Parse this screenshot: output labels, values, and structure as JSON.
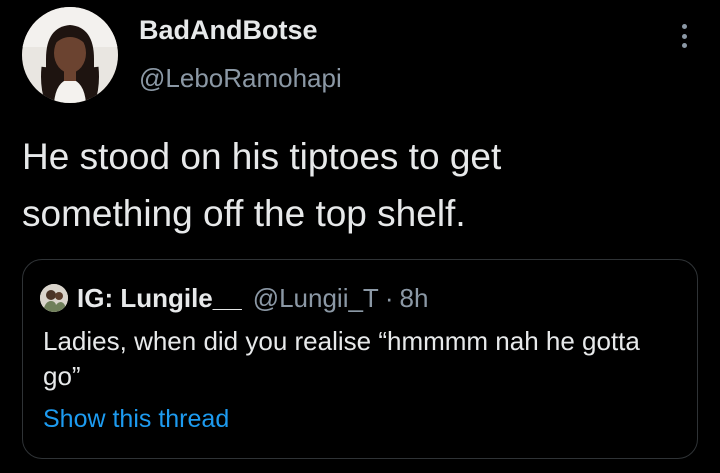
{
  "tweet": {
    "author": {
      "display_name": "BadAndBotse",
      "handle": "@LeboRamohapi"
    },
    "text": "He stood on his tiptoes to get something off the top shelf.",
    "more_icon": "more-vertical-icon"
  },
  "quoted_tweet": {
    "author": {
      "display_name": "IG: Lungile__",
      "handle": "@Lungii_T"
    },
    "separator": "·",
    "time": "8h",
    "text": "Ladies, when did you realise “hmmmm nah he gotta go”",
    "show_thread_label": "Show this thread"
  },
  "colors": {
    "background": "#000000",
    "primary_text": "#e7e9ea",
    "secondary_text": "#8b98a5",
    "link": "#1d9bf0",
    "border": "#2f3336"
  }
}
